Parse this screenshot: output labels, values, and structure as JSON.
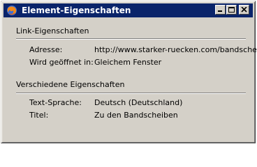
{
  "window": {
    "title": "Element-Eigenschaften",
    "app_icon": "firefox-icon",
    "controls": [
      "minimize-icon",
      "maximize-icon",
      "close-icon"
    ]
  },
  "sections": [
    {
      "heading": "Link-Eigenschaften",
      "rows": [
        {
          "label": "Adresse:",
          "value": "http://www.starker-ruecken.com/bandscheil"
        },
        {
          "label": "Wird geöffnet in:",
          "value": "Gleichem Fenster"
        }
      ]
    },
    {
      "heading": "Verschiedene Eigenschaften",
      "rows": [
        {
          "label": "Text-Sprache:",
          "value": "Deutsch (Deutschland)"
        },
        {
          "label": "Titel:",
          "value": "Zu den Bandscheiben"
        }
      ]
    }
  ]
}
